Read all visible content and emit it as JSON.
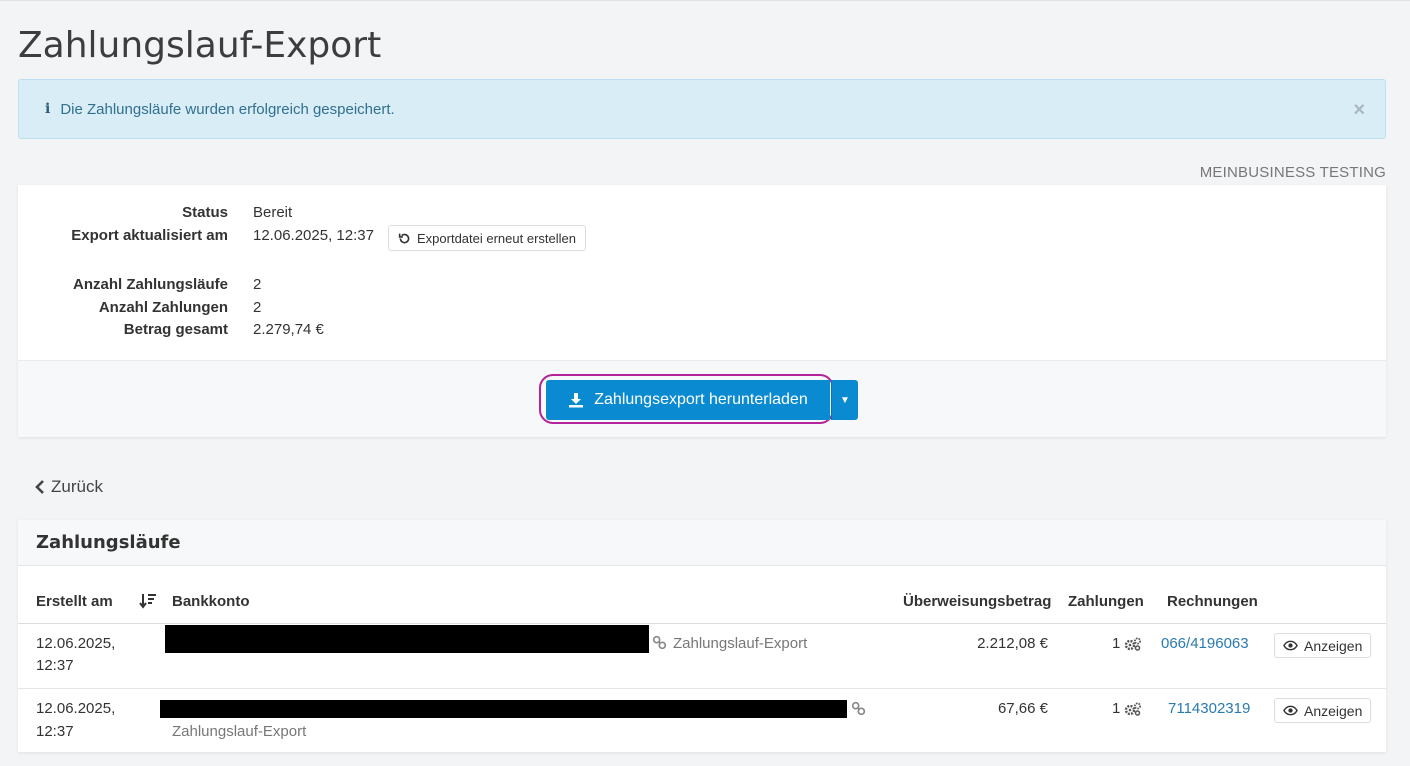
{
  "page": {
    "title": "Zahlungslauf-Export"
  },
  "alert": {
    "message": "Die Zahlungsläufe wurden erfolgreich gespeichert.",
    "icon": "info-icon",
    "close": "×"
  },
  "company": "MEINBUSINESS TESTING",
  "summary": {
    "status_label": "Status",
    "status_value": "Bereit",
    "updated_label": "Export aktualisiert am",
    "updated_value": "12.06.2025, 12:37",
    "regen_button": "Exportdatei erneut erstellen",
    "runs_label": "Anzahl Zahlungsläufe",
    "runs_value": "2",
    "payments_label": "Anzahl Zahlungen",
    "payments_value": "2",
    "total_label": "Betrag gesamt",
    "total_value": "2.279,74 €",
    "download_button": "Zahlungsexport herunterladen"
  },
  "back": "Zurück",
  "runs": {
    "title": "Zahlungsläufe",
    "columns": {
      "created": "Erstellt am",
      "account": "Bankkonto",
      "amount": "Überweisungsbetrag",
      "payments": "Zahlungen",
      "invoices": "Rechnungen"
    },
    "rows": [
      {
        "date": "12.06.2025,",
        "time": "12:37",
        "account_label": "Zahlungslauf-Export",
        "amount": "2.212,08 €",
        "payments": "1",
        "invoice": "066/4196063",
        "view": "Anzeigen"
      },
      {
        "date": "12.06.2025,",
        "time": "12:37",
        "account_label": "Zahlungslauf-Export",
        "amount": "67,66 €",
        "payments": "1",
        "invoice": "7114302319",
        "view": "Anzeigen"
      }
    ]
  },
  "colors": {
    "primary": "#0a8ad0",
    "highlight": "#b3239a",
    "alert_bg": "#d9edf7",
    "link": "#2a7ab0"
  }
}
